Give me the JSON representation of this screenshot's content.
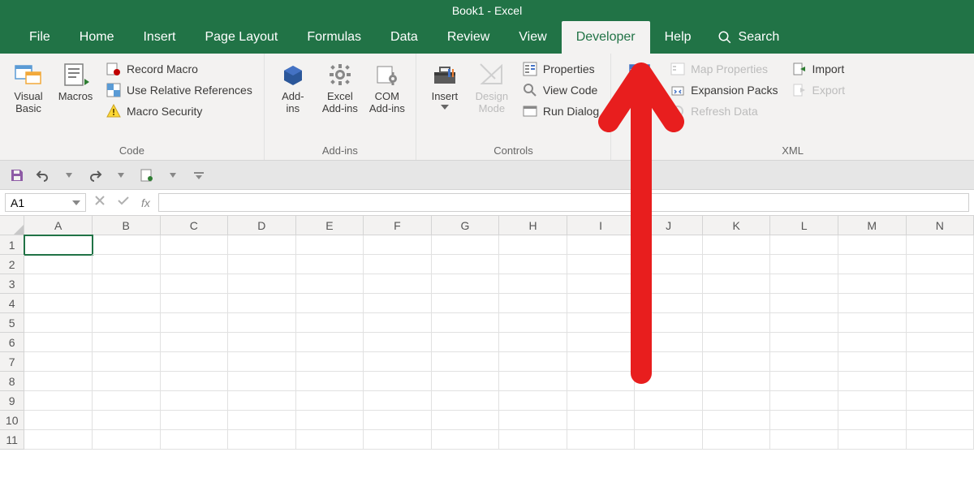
{
  "title": "Book1  -  Excel",
  "tabs": {
    "file": "File",
    "home": "Home",
    "insert": "Insert",
    "page_layout": "Page Layout",
    "formulas": "Formulas",
    "data": "Data",
    "review": "Review",
    "view": "View",
    "developer": "Developer",
    "help": "Help",
    "search": "Search"
  },
  "ribbon": {
    "code": {
      "visual_basic": "Visual\nBasic",
      "macros": "Macros",
      "record_macro": "Record Macro",
      "use_relative": "Use Relative References",
      "macro_security": "Macro Security",
      "group_label": "Code"
    },
    "addins": {
      "addins": "Add-\nins",
      "excel_addins": "Excel\nAdd-ins",
      "com_addins": "COM\nAdd-ins",
      "group_label": "Add-ins"
    },
    "controls": {
      "insert": "Insert",
      "design_mode": "Design\nMode",
      "properties": "Properties",
      "view_code": "View Code",
      "run_dialog": "Run Dialog",
      "group_label": "Controls"
    },
    "xml": {
      "source": "Source",
      "map_properties": "Map Properties",
      "expansion_packs": "Expansion Packs",
      "refresh_data": "Refresh Data",
      "import": "Import",
      "export": "Export",
      "group_label": "XML"
    }
  },
  "namebox": "A1",
  "fx_label": "fx",
  "columns": [
    "A",
    "B",
    "C",
    "D",
    "E",
    "F",
    "G",
    "H",
    "I",
    "J",
    "K",
    "L",
    "M",
    "N"
  ],
  "rows": [
    "1",
    "2",
    "3",
    "4",
    "5",
    "6",
    "7",
    "8",
    "9",
    "10",
    "11"
  ]
}
